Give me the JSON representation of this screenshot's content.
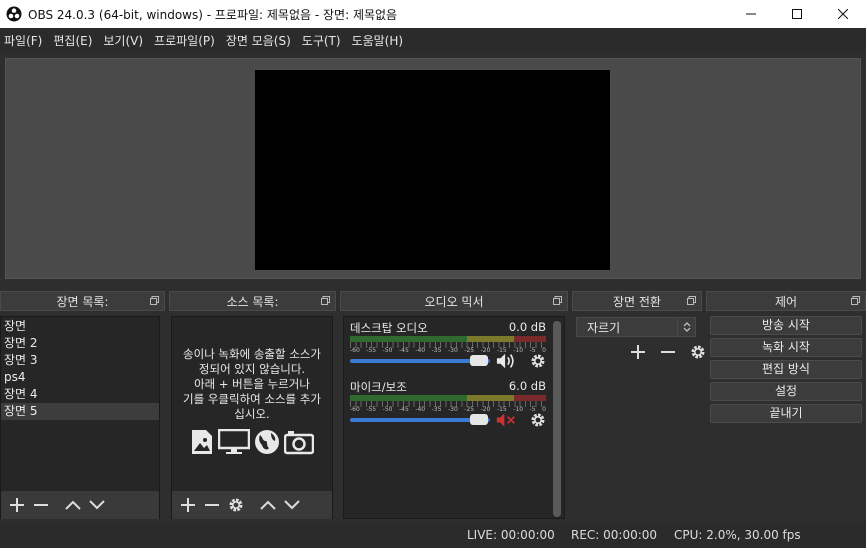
{
  "window": {
    "title": "OBS 24.0.3 (64-bit, windows) - 프로파일: 제목없음 - 장면: 제목없음",
    "controls": [
      "minimize-icon",
      "maximize-icon",
      "close-icon"
    ]
  },
  "menu": [
    "파일(F)",
    "편집(E)",
    "보기(V)",
    "프로파일(P)",
    "장면 모음(S)",
    "도구(T)",
    "도움말(H)"
  ],
  "docks": {
    "scenes": {
      "title": "장면 목록:",
      "items": [
        "장면",
        "장면 2",
        "장면 3",
        "ps4",
        "장면 4",
        "장면 5"
      ],
      "selected_index": 5
    },
    "sources": {
      "title": "소스 목록:",
      "empty_message_lines": [
        "송이나 녹화에 송출할 소스가",
        "정되어 있지 않습니다.",
        "아래 + 버튼을 누르거나",
        "기를 우클릭하여 소스를 추가",
        "십시오."
      ],
      "icons": [
        "image-icon",
        "monitor-icon",
        "globe-icon",
        "camera-icon"
      ]
    },
    "mixer": {
      "title": "오디오 믹서",
      "channels": [
        {
          "name": "데스크탑 오디오",
          "db": "0.0 dB",
          "muted": false,
          "volume": 0.86
        },
        {
          "name": "마이크/보조",
          "db": "6.0 dB",
          "muted": true,
          "volume": 0.86
        }
      ],
      "tick_labels": [
        "-60",
        "-55",
        "-50",
        "-45",
        "-40",
        "-35",
        "-30",
        "-25",
        "-20",
        "-15",
        "-10",
        "-5",
        "0"
      ]
    },
    "transitions": {
      "title": "장면 전환",
      "selected": "자르기"
    },
    "controls": {
      "title": "제어",
      "buttons": [
        "방송 시작",
        "녹화 시작",
        "편집 방식",
        "설정",
        "끝내기"
      ]
    }
  },
  "status": {
    "live": "LIVE: 00:00:00",
    "rec": "REC: 00:00:00",
    "cpu": "CPU: 2.0%, 30.00 fps"
  },
  "colors": {
    "accent": "#3a7bd5",
    "mute_red": "#d03030",
    "background": "#2e2e2e"
  }
}
